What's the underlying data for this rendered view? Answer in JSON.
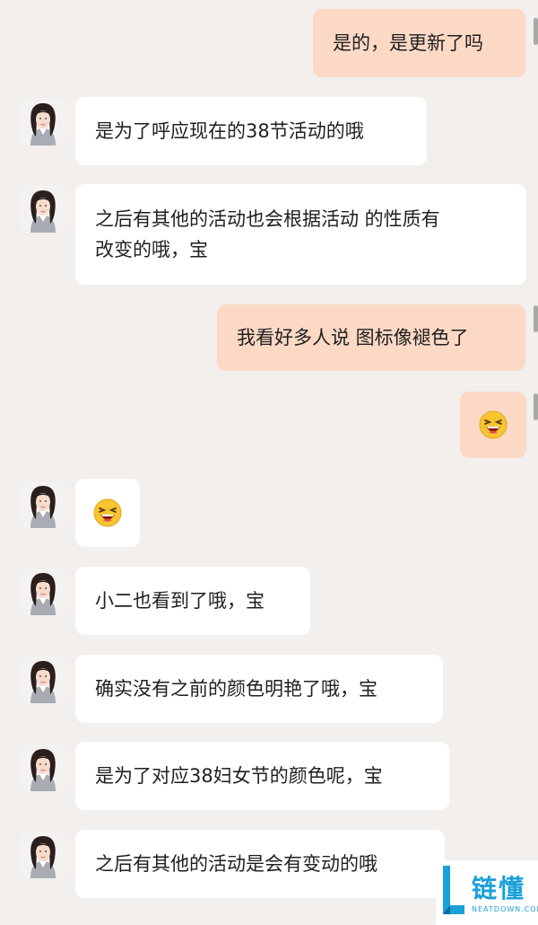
{
  "conversation": {
    "messages": [
      {
        "side": "me",
        "text": "是的，是更新了吗"
      },
      {
        "side": "agent",
        "text": "是为了呼应现在的38节活动的哦"
      },
      {
        "side": "agent",
        "line1": "之后有其他的活动也会根据活动 的性质有",
        "line2": "改变的哦，宝"
      },
      {
        "side": "me",
        "text": "我看好多人说 图标像褪色了"
      },
      {
        "side": "me",
        "emoji": "laughing-face-emoji"
      },
      {
        "side": "agent",
        "emoji": "laughing-face-emoji"
      },
      {
        "side": "agent",
        "text": "小二也看到了哦，宝"
      },
      {
        "side": "agent",
        "text": "确实没有之前的颜色明艳了哦，宝"
      },
      {
        "side": "agent",
        "text": "是为了对应38妇女节的颜色呢，宝"
      },
      {
        "side": "agent",
        "text": "之后有其他的活动是会有变动的哦"
      }
    ]
  },
  "watermark": {
    "brand": "链懂",
    "domain": "NEATDOWN.COM"
  },
  "colors": {
    "my_bubble": "#fbd9c5",
    "agent_bubble": "#ffffff",
    "background": "#f2efec",
    "watermark": "#1aa0d8"
  }
}
